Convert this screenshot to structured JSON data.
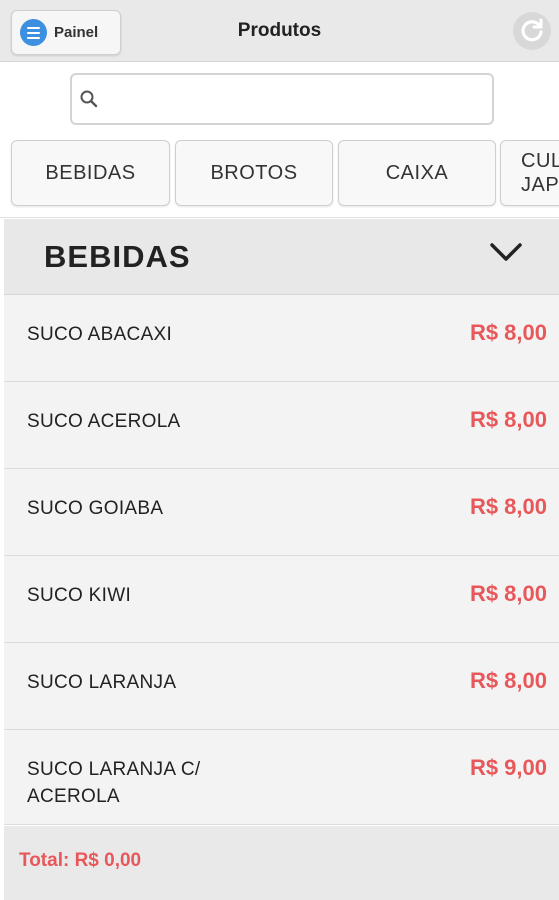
{
  "header": {
    "menu_label": "Painel",
    "title": "Produtos",
    "menu_icon": "menu-icon",
    "refresh_icon": "refresh-icon"
  },
  "search": {
    "value": "",
    "placeholder": "",
    "icon": "search-icon"
  },
  "categories": [
    {
      "label": "BEBIDAS"
    },
    {
      "label": "BROTOS"
    },
    {
      "label": "CAIXA"
    },
    {
      "label": "CUL\nJAP"
    }
  ],
  "section": {
    "title": "BEBIDAS",
    "toggle_icon": "chevron-down-icon"
  },
  "products": [
    {
      "name": "SUCO ABACAXI",
      "price": "R$ 8,00"
    },
    {
      "name": "SUCO ACEROLA",
      "price": "R$ 8,00"
    },
    {
      "name": "SUCO GOIABA",
      "price": "R$ 8,00"
    },
    {
      "name": "SUCO KIWI",
      "price": "R$ 8,00"
    },
    {
      "name": "SUCO LARANJA",
      "price": "R$ 8,00"
    },
    {
      "name": "SUCO LARANJA C/ ACEROLA",
      "price": "R$ 9,00"
    }
  ],
  "footer": {
    "total": "Total: R$ 0,00"
  },
  "colors": {
    "accent_blue": "#3d8fe0",
    "price_red": "#e8585a",
    "header_bg": "#e9e9e9"
  }
}
